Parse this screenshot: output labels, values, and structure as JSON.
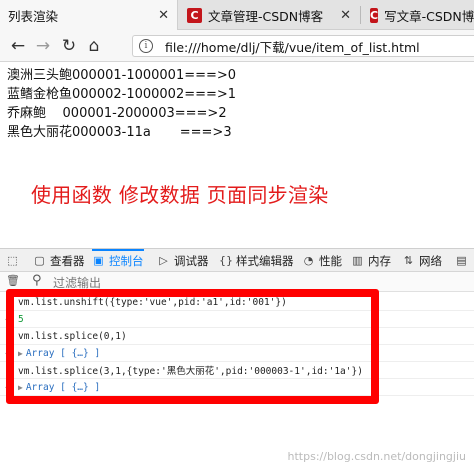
{
  "tabs": [
    {
      "title": "列表渲染",
      "close": "✕"
    },
    {
      "title": "文章管理-CSDN博客",
      "close": "✕",
      "favicon": "C"
    },
    {
      "title": "写文章-CSDN博客",
      "favicon": "C"
    }
  ],
  "nav": {
    "back": "←",
    "forward": "→",
    "reload": "↻",
    "home": "⌂",
    "info": "i",
    "url": "file:///home/dlj/下载/vue/item_of_list.html"
  },
  "list_rows": [
    "澳洲三头鲍000001-1000001===>0",
    "蓝鳍金枪鱼000002-1000002===>1",
    "乔麻鲍    000001-2000003===>2",
    "黑色大丽花000003-11a       ===>3"
  ],
  "headline": "使用函数 修改数据 页面同步渲染",
  "devtools": {
    "tabs": [
      {
        "label": "",
        "icon": "⬚"
      },
      {
        "label": "查看器",
        "icon": "▢"
      },
      {
        "label": "控制台",
        "icon": "▣"
      },
      {
        "label": "调试器",
        "icon": "▷"
      },
      {
        "label": "样式编辑器",
        "icon": "{}"
      },
      {
        "label": "性能",
        "icon": "◔"
      },
      {
        "label": "内存",
        "icon": "▥"
      },
      {
        "label": "网络",
        "icon": "⇅"
      },
      {
        "label": "",
        "icon": "▤"
      }
    ],
    "filter_placeholder": "过滤输出",
    "trash_icon": "🗑",
    "filter_icon": "⚲"
  },
  "console": [
    {
      "kind": "input",
      "text": "vm.list.unshift({type:'vue',pid:'a1',id:'001'})"
    },
    {
      "kind": "output-num",
      "text": "5"
    },
    {
      "kind": "input",
      "text": "vm.list.splice(0,1)"
    },
    {
      "kind": "output-arr",
      "text": "Array [ {…} ]"
    },
    {
      "kind": "input",
      "text": "vm.list.splice(3,1,{type:'黑色大丽花',pid:'000003-1',id:'1a'})"
    },
    {
      "kind": "output-arr",
      "text": "Array [ {…} ]"
    }
  ],
  "watermark": "https://blog.csdn.net/dongjingjiu",
  "colors": {
    "highlight": "#ff0000",
    "accent": "#0a84ff",
    "headline": "#e31b1b"
  }
}
